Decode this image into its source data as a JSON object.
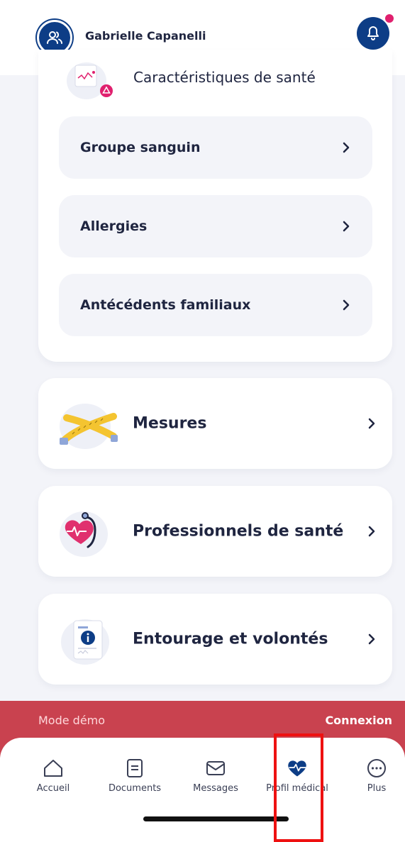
{
  "header": {
    "user_name": "Gabrielle Capanelli",
    "avatar_icon": "users-icon",
    "notification_icon": "bell-icon",
    "has_unread": true
  },
  "health_section": {
    "title": "Caractéristiques de santé",
    "rows": [
      {
        "label": "Groupe sanguin"
      },
      {
        "label": "Allergies"
      },
      {
        "label": "Antécédents familiaux"
      }
    ]
  },
  "cards": [
    {
      "label": "Mesures",
      "icon": "tape-measure-icon"
    },
    {
      "label": "Professionnels de santé",
      "icon": "stethoscope-heart-icon"
    },
    {
      "label": "Entourage et volontés",
      "icon": "info-document-icon"
    }
  ],
  "demo_banner": {
    "label": "Mode démo",
    "action": "Connexion"
  },
  "tabbar": {
    "items": [
      {
        "label": "Accueil",
        "icon": "home-icon"
      },
      {
        "label": "Documents",
        "icon": "document-icon"
      },
      {
        "label": "Messages",
        "icon": "mail-icon"
      },
      {
        "label": "Profil médical",
        "icon": "heart-pulse-icon",
        "active": true
      },
      {
        "label": "Plus",
        "icon": "more-icon"
      }
    ]
  },
  "colors": {
    "primary": "#0d3d86",
    "accent": "#e0206e",
    "demo_banner": "#c9424f",
    "highlight": "#ee1111"
  }
}
